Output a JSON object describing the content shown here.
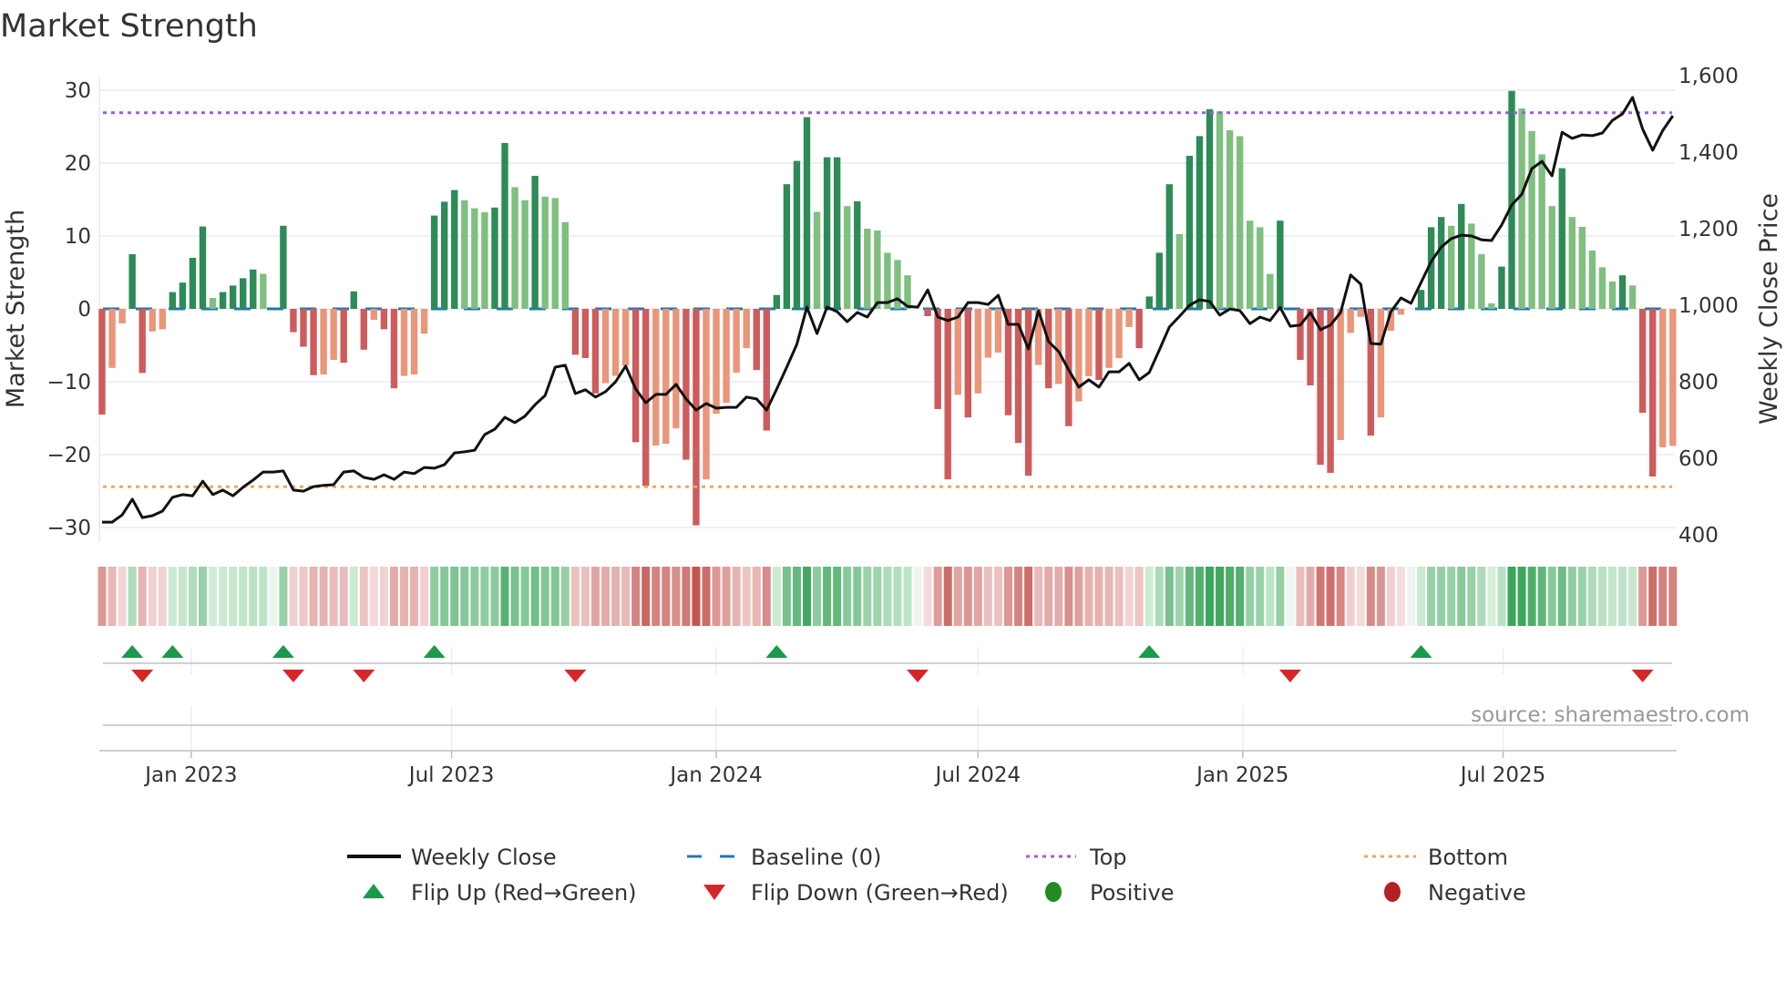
{
  "chart_data": {
    "type": "bar",
    "title": "Market Strength",
    "ylabel": "Market Strength",
    "y2label": "Weekly Close Price",
    "ylim": [
      -31.5,
      31.5
    ],
    "y2lim": [
      390,
      1620
    ],
    "yticks": [
      30,
      20,
      10,
      0,
      -10,
      -20,
      -30
    ],
    "ytick_labels": [
      "30",
      "20",
      "10",
      "0",
      "−10",
      "−20",
      "−30"
    ],
    "y2ticks": [
      1600,
      1400,
      1200,
      1000,
      800,
      600,
      400
    ],
    "y2tick_labels": [
      "1,600",
      "1,400",
      "1,200",
      "1,000",
      "800",
      "600",
      "400"
    ],
    "x_start": "2022-10-31",
    "x_step_days": 7,
    "xticks": [
      {
        "date": "2023-01-01",
        "label": "Jan 2023"
      },
      {
        "date": "2023-07-01",
        "label": "Jul 2023"
      },
      {
        "date": "2024-01-01",
        "label": "Jan 2024"
      },
      {
        "date": "2024-07-01",
        "label": "Jul 2024"
      },
      {
        "date": "2025-01-01",
        "label": "Jan 2025"
      },
      {
        "date": "2025-07-01",
        "label": "Jul 2025"
      }
    ],
    "top": 26.9,
    "bottom": -24.4,
    "baseline": 0,
    "strength": [
      -14.5,
      -8.1,
      -2.0,
      7.5,
      -8.8,
      -3.1,
      -2.8,
      2.3,
      3.6,
      7.0,
      11.3,
      1.5,
      2.3,
      3.2,
      4.2,
      5.4,
      4.8,
      0,
      11.4,
      -3.2,
      -5.2,
      -9.1,
      -9.0,
      -7.0,
      -7.4,
      2.4,
      -5.6,
      -1.5,
      -2.8,
      -10.9,
      -9.2,
      -9.0,
      -3.4,
      12.8,
      14.7,
      16.3,
      14.9,
      13.8,
      13.25,
      13.9,
      22.75,
      16.7,
      14.9,
      18.25,
      15.4,
      15.2,
      11.9,
      -6.3,
      -6.75,
      -11.6,
      -10.2,
      -9.2,
      -7.8,
      -18.3,
      -24.3,
      -18.75,
      -18.5,
      -16.4,
      -20.7,
      -29.7,
      -23.4,
      -14.4,
      -12.9,
      -8.75,
      -5.4,
      -8.4,
      -16.7,
      1.9,
      17.1,
      20.3,
      26.3,
      13.3,
      20.8,
      20.8,
      14.1,
      14.75,
      11.0,
      10.75,
      7.7,
      6.7,
      4.6,
      0,
      -1.0,
      -13.75,
      -23.4,
      -11.8,
      -14.9,
      -11.6,
      -6.7,
      -6.0,
      -14.6,
      -18.4,
      -22.9,
      -7.7,
      -10.9,
      -10.3,
      -16.1,
      -12.7,
      -9.25,
      -9.75,
      -8.1,
      -6.75,
      -2.5,
      -5.4,
      1.7,
      7.7,
      17.1,
      10.25,
      21,
      23.7,
      27.4,
      27.1,
      24.5,
      23.7,
      12.1,
      11.2,
      4.8,
      12.1,
      0,
      -7.0,
      -10.5,
      -21.4,
      -22.5,
      -18.0,
      -3.3,
      -1.1,
      -17.4,
      -14.9,
      -3.0,
      -0.8,
      0,
      2.6,
      11.2,
      12.6,
      11.4,
      14.4,
      11.7,
      7.5,
      0.75,
      5.8,
      29.9,
      27.5,
      24.4,
      21.2,
      14.1,
      19.3,
      12.6,
      11.25,
      8.0,
      5.7,
      3.75,
      4.6,
      3.2,
      -14.25,
      -23.0,
      -19.0,
      -18.8
    ],
    "close": [
      433,
      433,
      452,
      493,
      445,
      450,
      462,
      498,
      505,
      502,
      540,
      505,
      517,
      502,
      524,
      543,
      564,
      564,
      567,
      517,
      514,
      526,
      529,
      531,
      564,
      567,
      550,
      545,
      557,
      545,
      564,
      560,
      576,
      574,
      583,
      614,
      617,
      621,
      662,
      676,
      707,
      693,
      710,
      740,
      764,
      838,
      843,
      769,
      779,
      760,
      774,
      800,
      841,
      781,
      745,
      767,
      767,
      793,
      755,
      726,
      743,
      731,
      733,
      733,
      760,
      755,
      726,
      781,
      838,
      898,
      995,
      926,
      995,
      983,
      957,
      981,
      969,
      1007,
      1007,
      1017,
      997,
      995,
      1040,
      969,
      960,
      969,
      1007,
      1007,
      1002,
      1026,
      950,
      950,
      886,
      986,
      905,
      879,
      831,
      786,
      805,
      786,
      826,
      826,
      848,
      805,
      824,
      883,
      943,
      971,
      1000,
      1014,
      1010,
      974,
      990,
      986,
      952,
      969,
      960,
      994,
      945,
      948,
      981,
      936,
      948,
      981,
      1079,
      1055,
      900,
      898,
      983,
      1019,
      1005,
      1060,
      1114,
      1152,
      1174,
      1183,
      1181,
      1171,
      1169,
      1210,
      1262,
      1290,
      1357,
      1376,
      1338,
      1452,
      1436,
      1445,
      1443,
      1450,
      1483,
      1500,
      1543,
      1460,
      1405,
      1457,
      1495
    ],
    "flip_up_index": [
      3,
      7,
      18,
      33,
      67,
      104,
      131
    ],
    "flip_down_index": [
      4,
      19,
      26,
      47,
      81,
      118,
      153
    ],
    "colors": {
      "pos_rising": "#2e8b57",
      "pos_falling": "#7fbf7f",
      "neg_falling": "#cd5c5c",
      "neg_rising": "#e9967a",
      "close": "#111111",
      "baseline": "#1f77b4",
      "top": "#9b5de5",
      "bottom": "#f4a460",
      "flip_up": "#1a9a4a",
      "flip_down": "#d62728",
      "positive": "#228b22",
      "negative": "#b22222"
    },
    "legend": {
      "placement": "bottom-center",
      "items": [
        {
          "label": "Weekly Close",
          "kind": "line"
        },
        {
          "label": "Baseline (0)",
          "kind": "dash"
        },
        {
          "label": "Top",
          "kind": "dot-purple"
        },
        {
          "label": "Bottom",
          "kind": "dot-orange"
        },
        {
          "label": "Flip Up (Red→Green)",
          "kind": "tri-up"
        },
        {
          "label": "Flip Down (Green→Red)",
          "kind": "tri-down"
        },
        {
          "label": "Positive",
          "kind": "dot-green"
        },
        {
          "label": "Negative",
          "kind": "dot-red"
        }
      ]
    },
    "source": "source: sharemaestro.com"
  }
}
